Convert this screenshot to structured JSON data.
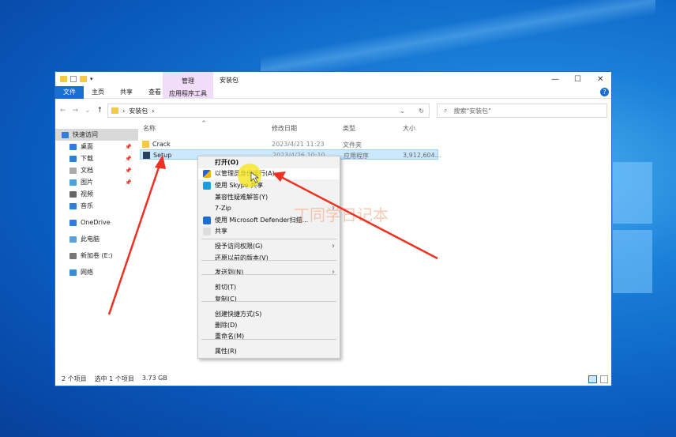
{
  "window": {
    "title": "安装包",
    "context_tab": "管理",
    "context_subtab": "应用程序工具",
    "minimize": "—",
    "maximize": "☐",
    "close": "✕",
    "help": "?"
  },
  "ribbon": {
    "tabs": [
      "文件",
      "主页",
      "共享",
      "查看"
    ]
  },
  "address": {
    "path": "安装包",
    "separator": "›"
  },
  "search": {
    "placeholder": "搜索\"安装包\""
  },
  "sidebar": {
    "items": [
      {
        "label": "快速访问",
        "icon": "star-icon",
        "pinned": false
      },
      {
        "label": "桌面",
        "icon": "desktop-icon",
        "pinned": true
      },
      {
        "label": "下载",
        "icon": "download-icon",
        "pinned": true
      },
      {
        "label": "文档",
        "icon": "document-icon",
        "pinned": true
      },
      {
        "label": "图片",
        "icon": "picture-icon",
        "pinned": true
      },
      {
        "label": "视频",
        "icon": "video-icon",
        "pinned": false
      },
      {
        "label": "音乐",
        "icon": "music-icon",
        "pinned": false
      },
      {
        "label": "OneDrive",
        "icon": "cloud-icon",
        "pinned": false
      },
      {
        "label": "此电脑",
        "icon": "computer-icon",
        "pinned": false
      },
      {
        "label": "新加卷 (E:)",
        "icon": "drive-icon",
        "pinned": false
      },
      {
        "label": "网络",
        "icon": "network-icon",
        "pinned": false
      }
    ]
  },
  "columns": [
    "名称",
    "修改日期",
    "类型",
    "大小"
  ],
  "files": [
    {
      "name": "Crack",
      "date": "2023/4/21 11:23",
      "type": "文件夹",
      "size": "",
      "icon": "folder-icon"
    },
    {
      "name": "Setup",
      "date": "2023/4/26 10:10",
      "type": "应用程序",
      "size": "3,912,604...",
      "icon": "app-icon"
    }
  ],
  "status": {
    "count": "2 个项目",
    "selected": "选中 1 个项目",
    "size": "3.73 GB"
  },
  "context_menu": {
    "items": [
      {
        "label": "打开(O)",
        "bold": true
      },
      {
        "label": "以管理员身份运行(A)",
        "icon": "shield-icon",
        "highlight": true
      },
      {
        "label": "使用 Skype 共享",
        "icon": "skype-icon"
      },
      {
        "label": "兼容性疑难解答(Y)"
      },
      {
        "label": "7-Zip",
        "submenu": true
      },
      {
        "label": "使用 Microsoft Defender扫描...",
        "icon": "defender-icon"
      },
      {
        "label": "共享",
        "icon": "share-icon"
      },
      {
        "label": "授予访问权限(G)",
        "submenu": true
      },
      {
        "label": "还原以前的版本(V)"
      },
      {
        "label": "发送到(N)",
        "submenu": true
      },
      {
        "label": "剪切(T)"
      },
      {
        "label": "复制(C)"
      },
      {
        "label": "创建快捷方式(S)"
      },
      {
        "label": "删除(D)"
      },
      {
        "label": "重命名(M)"
      },
      {
        "label": "属性(R)"
      }
    ]
  },
  "watermark": "丁同学日记本",
  "colors": {
    "accent": "#1a6ed0",
    "selection": "#cce8ff",
    "annotation": "#f03020",
    "cursor_highlight": "#f5e61e"
  }
}
